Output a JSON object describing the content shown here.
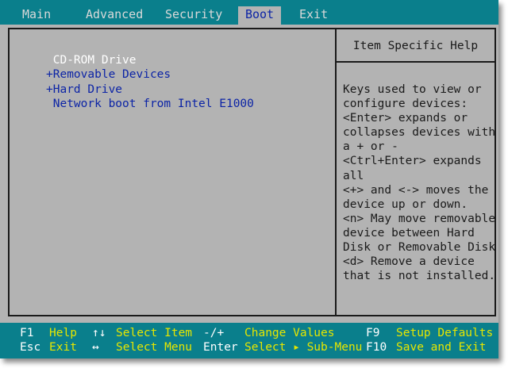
{
  "menu": {
    "items": [
      "Main",
      "Advanced",
      "Security",
      "Boot",
      "Exit"
    ],
    "active": "Boot"
  },
  "boot_list": {
    "items": [
      {
        "label": " CD-ROM Drive",
        "selected": true
      },
      {
        "label": "+Removable Devices",
        "selected": false
      },
      {
        "label": "+Hard Drive",
        "selected": false
      },
      {
        "label": " Network boot from Intel E1000",
        "selected": false
      }
    ]
  },
  "help": {
    "title": "Item Specific Help",
    "lines": [
      "Keys used to view or",
      "configure devices:",
      "<Enter> expands or",
      "collapses devices with",
      "a + or -",
      "<Ctrl+Enter> expands",
      "all",
      "<+> and <-> moves the",
      "device up or down.",
      "<n> May move removable",
      "device between Hard",
      "Disk or Removable Disk",
      "<d> Remove a device",
      "that is not installed."
    ]
  },
  "footer": {
    "f1_key": "F1",
    "f1_desc": "Help",
    "esc_key": "Esc",
    "esc_desc": "Exit",
    "updown_key": "↑↓",
    "updown_desc": "Select Item",
    "leftright_key": "↔",
    "leftright_desc": "Select Menu",
    "minusplus_key": "-/+",
    "minusplus_desc": "Change Values",
    "enter_key": "Enter",
    "enter_desc": "Select ▸ Sub-Menu",
    "f9_key": "F9",
    "f9_desc": "Setup Defaults",
    "f10_key": "F10",
    "f10_desc": "Save and Exit"
  },
  "colors": {
    "background": "#b3b3b3",
    "menubar": "#0a7f8c",
    "selected_text": "#ffffff",
    "item_text": "#0c24a6",
    "footer_desc": "#e6e600"
  }
}
